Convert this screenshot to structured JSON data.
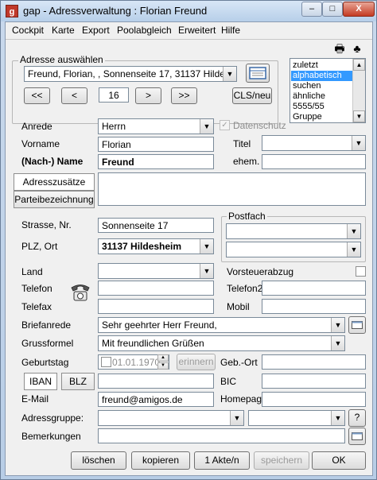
{
  "window": {
    "app_icon_letter": "g",
    "title": "gap - Adressverwaltung : Florian Freund",
    "minimize_label": "‒",
    "maximize_label": "□",
    "close_label": "X"
  },
  "menu": [
    "Cockpit",
    "Karte",
    "Export",
    "Poolabgleich",
    "Erweitert",
    "Hilfe"
  ],
  "toolbar": {
    "icons": [
      "printer-icon",
      "clubs-icon"
    ],
    "printer_glyph": "🖶",
    "clubs_glyph": "♣"
  },
  "address_select": {
    "group_label": "Adresse auswählen",
    "selected_address": "Freund, Florian, , Sonnenseite 17, 31137 Hildesheim",
    "nav_first": "<<",
    "nav_prev": "<",
    "current_number": "16",
    "nav_next": ">",
    "nav_last": ">>",
    "cls_button": "CLS/neu"
  },
  "sort_list": {
    "items": [
      "zuletzt",
      "alphabetisch",
      "suchen",
      "ähnliche",
      "5555/55",
      "Gruppe"
    ],
    "selected": "alphabetisch"
  },
  "labels": {
    "anrede": "Anrede",
    "datenschutz": "Datenschutz",
    "vorname": "Vorname",
    "titel": "Titel",
    "nachname": "(Nach-) Name",
    "ehem": "ehem.",
    "tab_adresszusaetze": "Adresszusätze",
    "tab_parteibezeichnung": "Parteibezeichnung",
    "strasse": "Strasse, Nr.",
    "postfach": "Postfach",
    "plz_ort": "PLZ, Ort",
    "land": "Land",
    "vorsteuerabzug": "Vorsteuerabzug",
    "telefon": "Telefon",
    "telefon2": "Telefon2",
    "telefax": "Telefax",
    "mobil": "Mobil",
    "briefanrede": "Briefanrede",
    "grussformel": "Grussformel",
    "geburtstag": "Geburtstag",
    "erinnern": "erinnern",
    "geb_ort": "Geb.-Ort",
    "iban": "IBAN",
    "blz": "BLZ",
    "bic": "BIC",
    "email": "E-Mail",
    "homepage": "Homepage",
    "adressgruppe": "Adressgruppe:",
    "bemerkungen": "Bemerkungen",
    "help_button": "?"
  },
  "values": {
    "anrede": "Herrn",
    "vorname": "Florian",
    "nachname": "Freund",
    "strasse": "Sonnenseite 17",
    "plz_ort": "31137 Hildesheim",
    "briefanrede": "Sehr geehrter Herr Freund,",
    "grussformel": "Mit freundlichen Grüßen",
    "geburtstag": "01.01.1970",
    "email": "freund@amigos.de"
  },
  "buttons": {
    "loeschen": "löschen",
    "kopieren": "kopieren",
    "akten": "1 Akte/n",
    "speichern": "speichern",
    "ok": "OK"
  }
}
